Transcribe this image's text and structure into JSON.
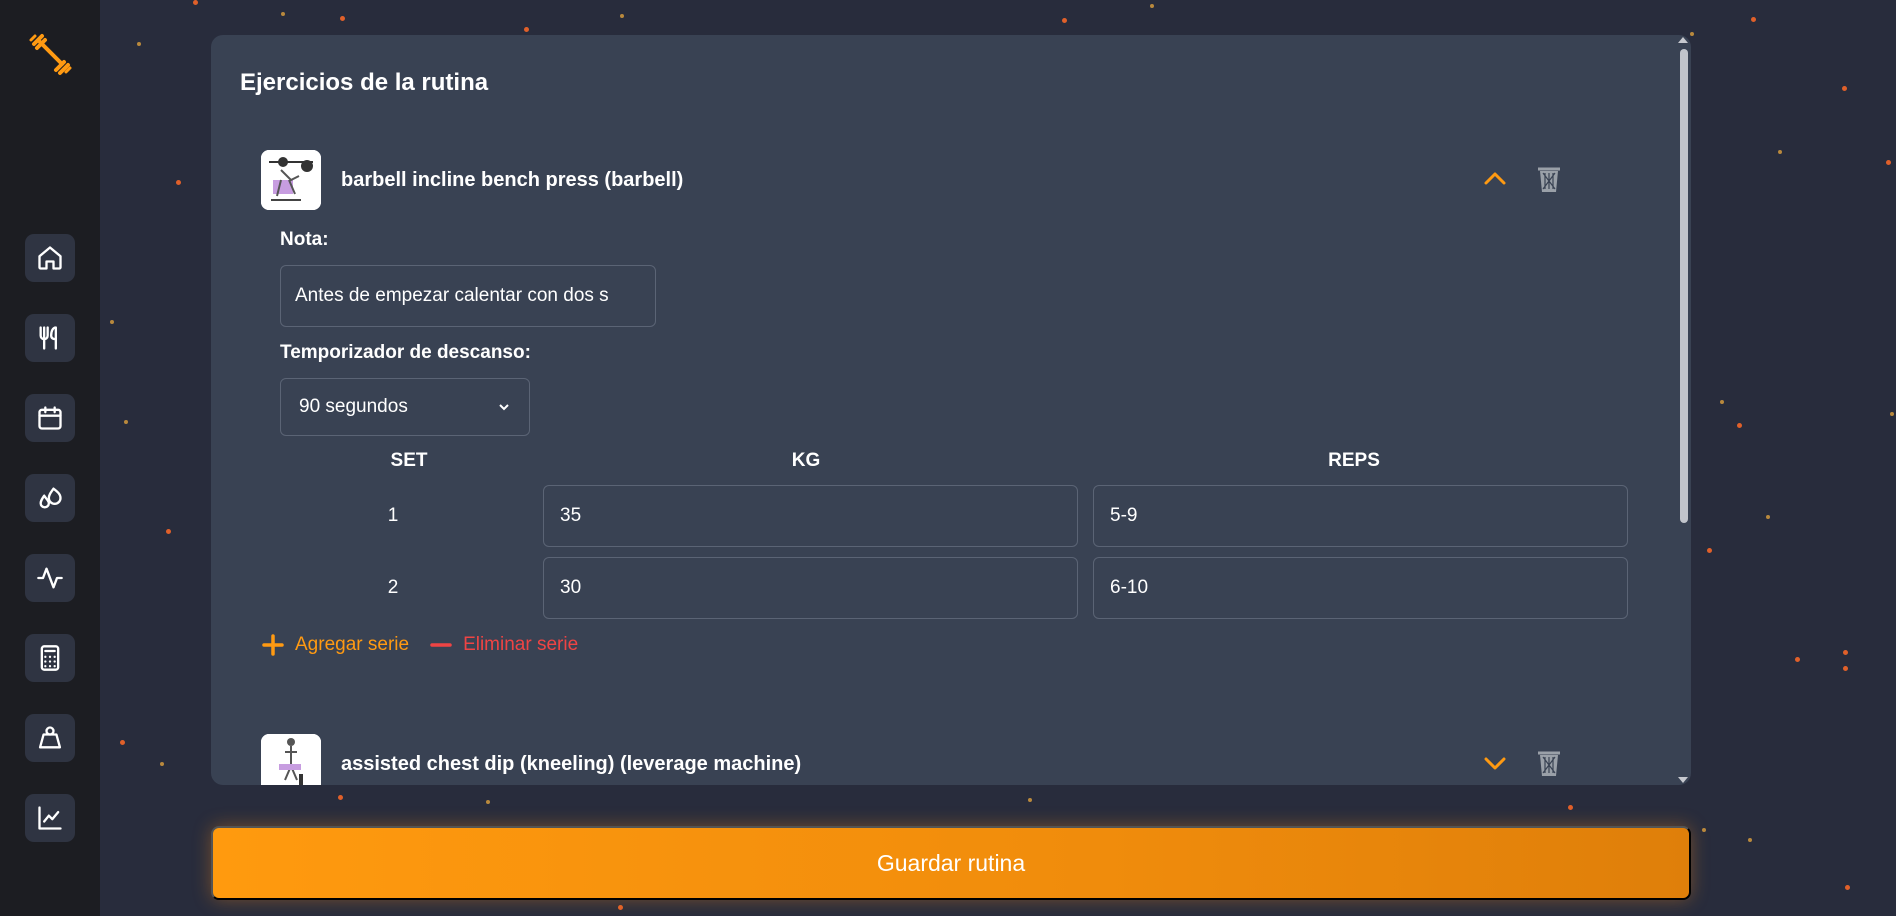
{
  "sidebar": {
    "items": [
      {
        "id": "home",
        "icon": "home-icon"
      },
      {
        "id": "nutrition",
        "icon": "fork-knife-icon"
      },
      {
        "id": "calendar",
        "icon": "calendar-icon"
      },
      {
        "id": "hydration",
        "icon": "droplets-icon"
      },
      {
        "id": "activity",
        "icon": "activity-pulse-icon"
      },
      {
        "id": "calculator",
        "icon": "calculator-icon"
      },
      {
        "id": "weight",
        "icon": "weight-icon"
      },
      {
        "id": "progress",
        "icon": "line-chart-icon"
      }
    ]
  },
  "panel": {
    "title": "Ejercicios de la rutina"
  },
  "exercises": [
    {
      "name": "barbell incline bench press (barbell)",
      "expanded": true,
      "note_label": "Nota:",
      "note_value": "Antes de empezar calentar con dos s",
      "timer_label": "Temporizador de descanso:",
      "timer_value": "90 segundos",
      "columns": [
        "SET",
        "KG",
        "REPS"
      ],
      "sets": [
        {
          "set": "1",
          "kg": "35",
          "reps": "5-9"
        },
        {
          "set": "2",
          "kg": "30",
          "reps": "6-10"
        }
      ],
      "add_label": "Agregar serie",
      "remove_label": "Eliminar serie"
    },
    {
      "name": "assisted chest dip (kneeling) (leverage machine)",
      "expanded": false
    }
  ],
  "save_label": "Guardar rutina",
  "colors": {
    "accent": "#ff9a12",
    "danger": "#ef4444",
    "panel": "#394253",
    "background": "#282c3c",
    "sidebar": "#1c1d22"
  }
}
